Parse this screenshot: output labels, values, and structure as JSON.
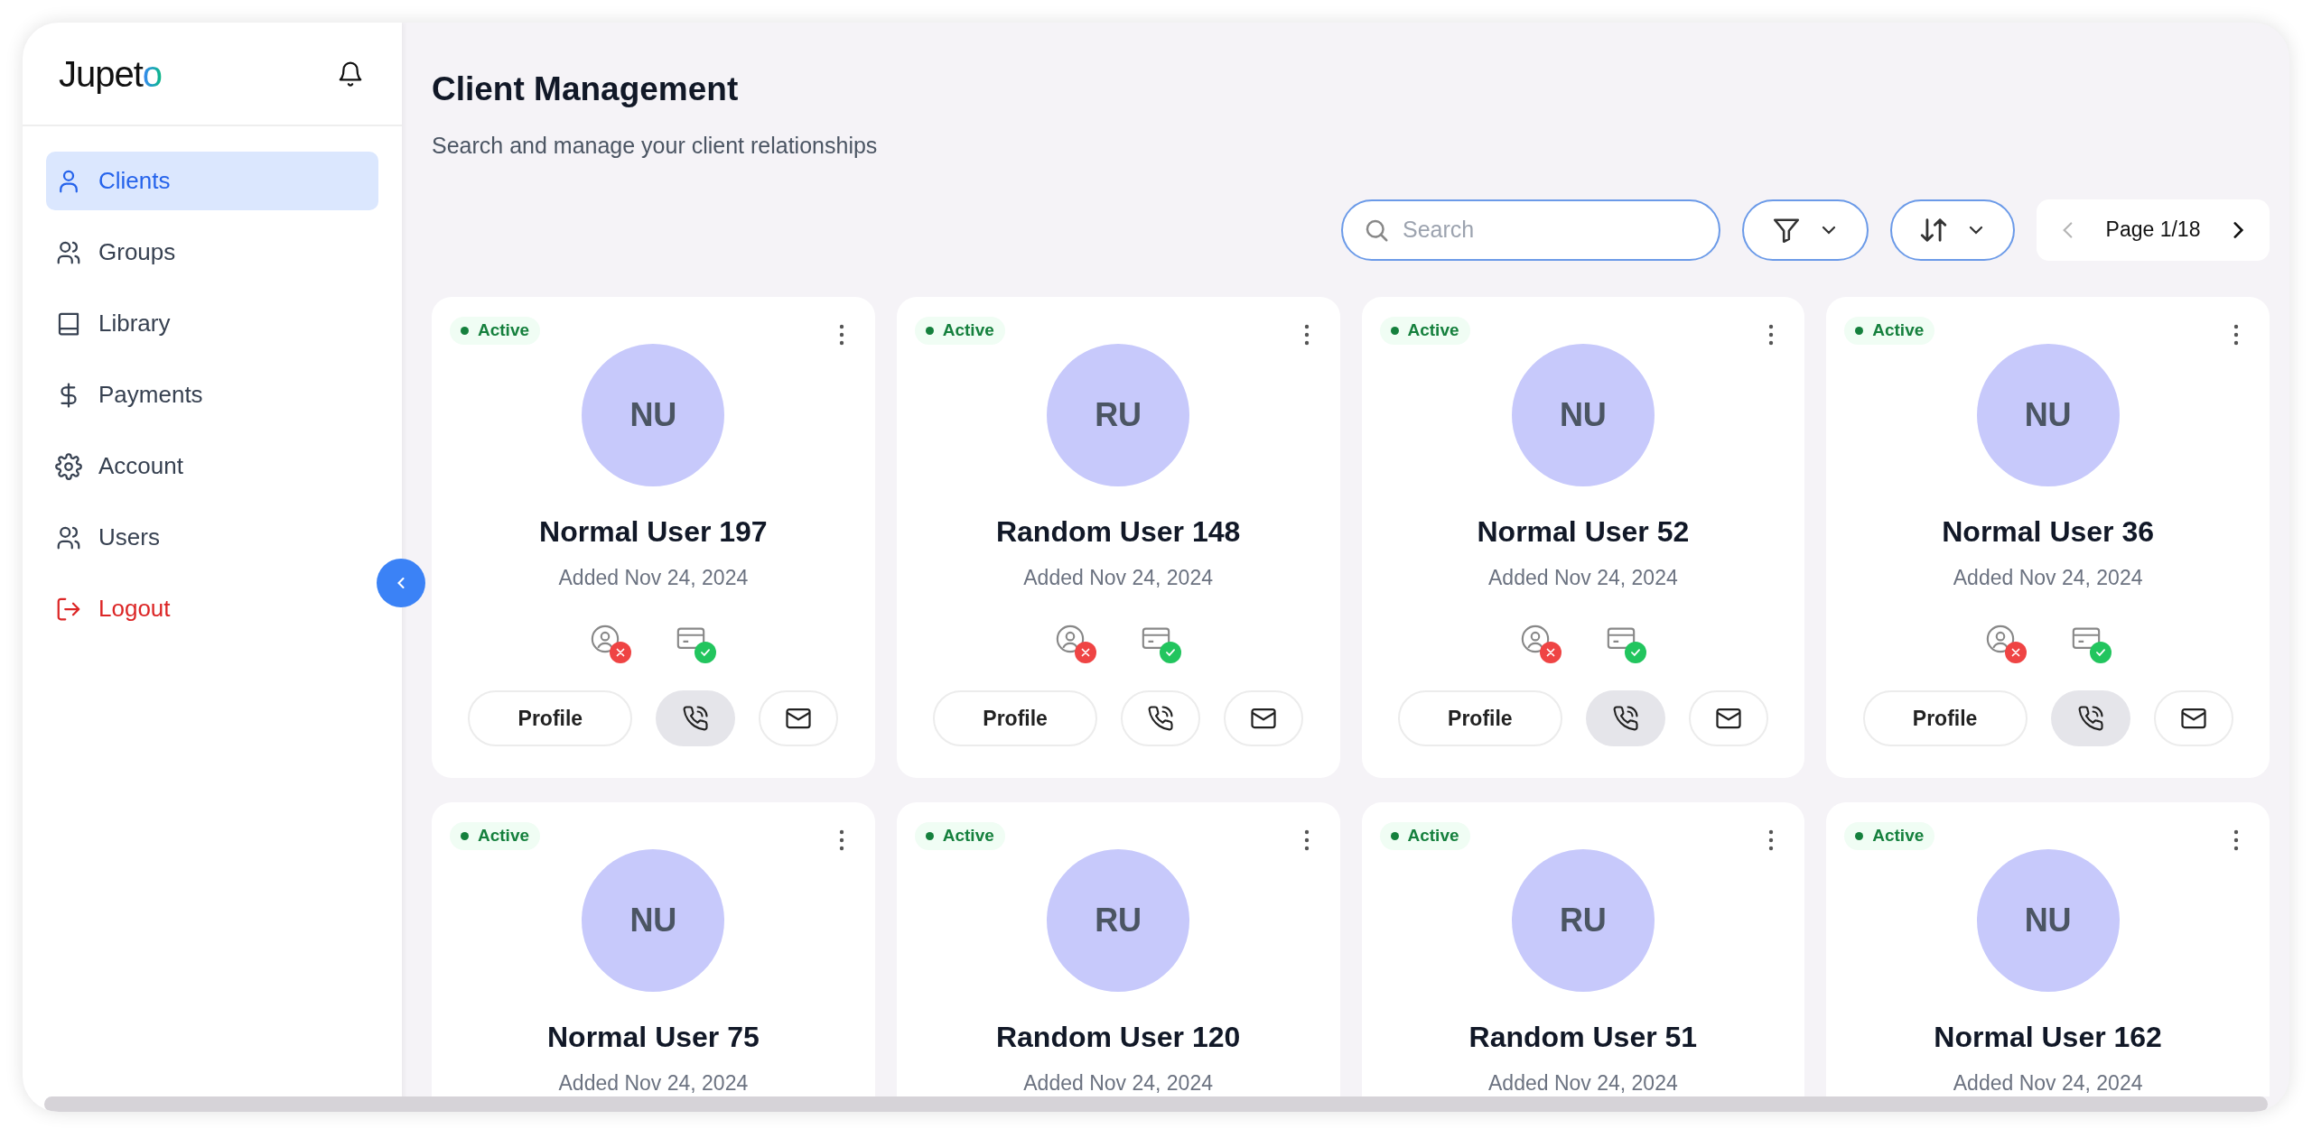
{
  "sidebar": {
    "logo": "Jupeto",
    "items": [
      {
        "label": "Clients",
        "selected": true,
        "kind": "nav"
      },
      {
        "label": "Groups",
        "selected": false,
        "kind": "nav"
      },
      {
        "label": "Library",
        "selected": false,
        "kind": "nav"
      },
      {
        "label": "Payments",
        "selected": false,
        "kind": "nav"
      },
      {
        "label": "Account",
        "selected": false,
        "kind": "nav"
      },
      {
        "label": "Users",
        "selected": false,
        "kind": "nav"
      },
      {
        "label": "Logout",
        "selected": false,
        "kind": "logout"
      }
    ]
  },
  "header": {
    "title": "Client Management",
    "subtitle": "Search and manage your client relationships"
  },
  "toolbar": {
    "search": {
      "placeholder": "Search"
    },
    "pager": {
      "label": "Page 1/18",
      "prev_disabled": true
    }
  },
  "cards": [
    {
      "status": "Active",
      "initials": "NU",
      "name": "Normal User 197",
      "added": "Added Nov 24, 2024",
      "profile_complete": false,
      "payment_complete": true,
      "profile_button": "Profile",
      "call_highlighted": true
    },
    {
      "status": "Active",
      "initials": "RU",
      "name": "Random User 148",
      "added": "Added Nov 24, 2024",
      "profile_complete": false,
      "payment_complete": true,
      "profile_button": "Profile",
      "call_highlighted": false
    },
    {
      "status": "Active",
      "initials": "NU",
      "name": "Normal User 52",
      "added": "Added Nov 24, 2024",
      "profile_complete": false,
      "payment_complete": true,
      "profile_button": "Profile",
      "call_highlighted": true
    },
    {
      "status": "Active",
      "initials": "NU",
      "name": "Normal User 36",
      "added": "Added Nov 24, 2024",
      "profile_complete": false,
      "payment_complete": true,
      "profile_button": "Profile",
      "call_highlighted": true
    },
    {
      "status": "Active",
      "initials": "NU",
      "name": "Normal User 75",
      "added": "Added Nov 24, 2024"
    },
    {
      "status": "Active",
      "initials": "RU",
      "name": "Random User 120",
      "added": "Added Nov 24, 2024"
    },
    {
      "status": "Active",
      "initials": "RU",
      "name": "Random User 51",
      "added": "Added Nov 24, 2024"
    },
    {
      "status": "Active",
      "initials": "NU",
      "name": "Normal User 162",
      "added": "Added Nov 24, 2024"
    }
  ]
}
